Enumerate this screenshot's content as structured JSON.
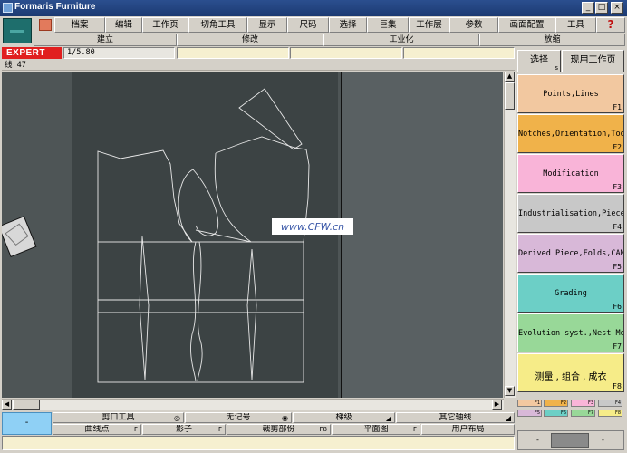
{
  "window": {
    "title": "Formaris Furniture",
    "buttons": [
      "_",
      "□",
      "×"
    ]
  },
  "menu": [
    "档案",
    "编辑",
    "工作页",
    "切角工具",
    "显示",
    "尺码",
    "选择",
    "巨集",
    "工作层",
    "参数",
    "画面配置",
    "工具",
    "?"
  ],
  "submenu": [
    "建立",
    "修改",
    "工业化",
    "放缩"
  ],
  "mode": {
    "label": "EXPERT",
    "zoom": "1/5.80"
  },
  "status": "线 47",
  "right_top": {
    "select": "选择",
    "select_key": "s",
    "current_page": "现用工作页"
  },
  "function_panels": [
    {
      "label": "Points,Lines",
      "key": "F1",
      "color": "#f2c8a0"
    },
    {
      "label": "Notches,Orientation,Tools",
      "key": "F2",
      "color": "#f0b24a"
    },
    {
      "label": "Modification",
      "key": "F3",
      "color": "#f9b4d8"
    },
    {
      "label": "Industrialisation,Piece",
      "key": "F4",
      "color": "#c8c8c8"
    },
    {
      "label": "Derived Piece,Folds,CAM",
      "key": "F5",
      "color": "#d8b8d8"
    },
    {
      "label": "Grading",
      "key": "F6",
      "color": "#6ccfc6"
    },
    {
      "label": "Evolution syst.,Nest Modi",
      "key": "F7",
      "color": "#98d898"
    },
    {
      "label": "测量 , 组合 , 成衣",
      "key": "F8",
      "color": "#f6ec88"
    }
  ],
  "mini_keys": [
    "F1",
    "F2",
    "F3",
    "F4",
    "F5",
    "F6",
    "F7",
    "F8"
  ],
  "watermark": "www.CFW.cn",
  "bottom": {
    "blue_button": "-",
    "row1": [
      {
        "label": "剪口工具",
        "key": ""
      },
      {
        "label": "无记号",
        "key": ""
      },
      {
        "label": "梯级",
        "key": ""
      },
      {
        "label": "其它轴线",
        "key": ""
      }
    ],
    "row2": [
      {
        "label": "曲线点",
        "key": "F"
      },
      {
        "label": "影子",
        "key": "F"
      },
      {
        "label": "裁剪部份",
        "key": "F8"
      },
      {
        "label": "平面图",
        "key": "F"
      },
      {
        "label": "用户布局",
        "key": ""
      }
    ]
  },
  "nav": {
    "prev": "-",
    "next": "-"
  }
}
